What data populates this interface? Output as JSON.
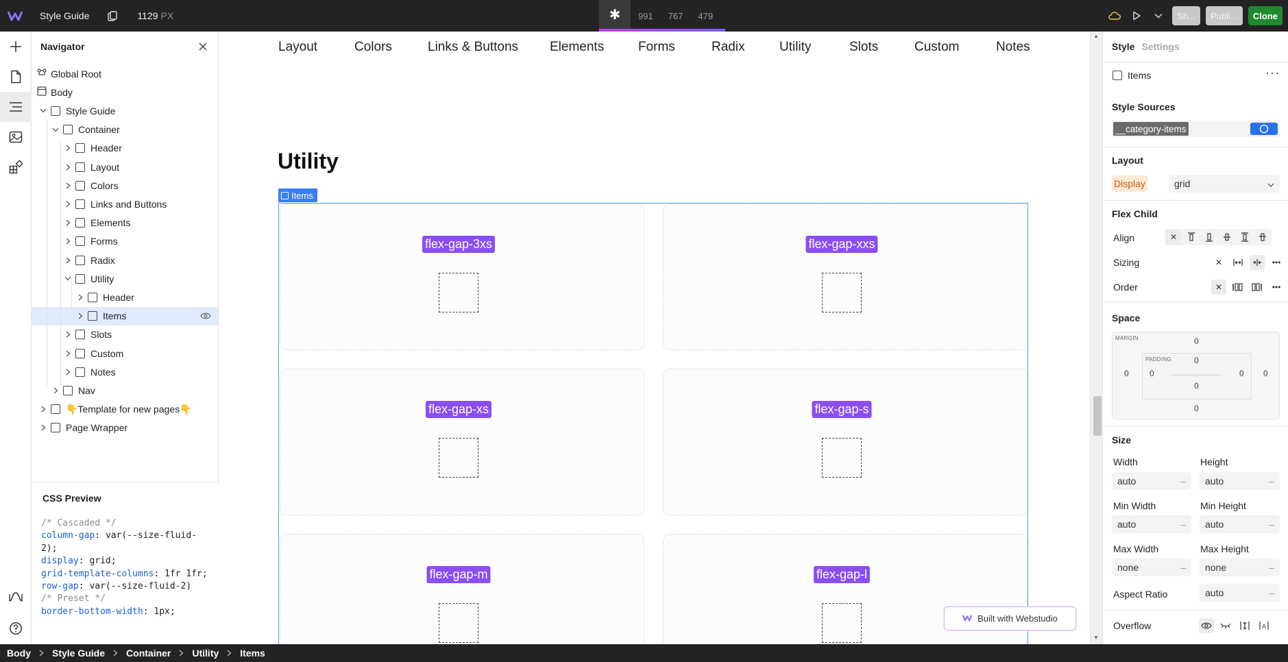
{
  "topbar": {
    "project_name": "Style Guide",
    "canvas_width": "1129",
    "canvas_unit": "PX",
    "breakpoints": [
      "991",
      "767",
      "479"
    ],
    "share_label": "Sh...",
    "publish_label": "Publi...",
    "clone_label": "Clone"
  },
  "navigator": {
    "title": "Navigator",
    "tree": [
      {
        "label": "Global Root",
        "depth": 0,
        "icon": "global-root-icon",
        "expand": "none"
      },
      {
        "label": "Body",
        "depth": 0,
        "icon": "body-icon",
        "expand": "none"
      },
      {
        "label": "Style Guide",
        "depth": 1,
        "icon": "box-icon",
        "expand": "open"
      },
      {
        "label": "Container",
        "depth": 2,
        "icon": "box-icon",
        "expand": "open"
      },
      {
        "label": "Header",
        "depth": 3,
        "icon": "box-icon",
        "expand": "closed"
      },
      {
        "label": "Layout",
        "depth": 3,
        "icon": "box-icon",
        "expand": "closed"
      },
      {
        "label": "Colors",
        "depth": 3,
        "icon": "box-icon",
        "expand": "closed"
      },
      {
        "label": "Links and Buttons",
        "depth": 3,
        "icon": "box-icon",
        "expand": "closed"
      },
      {
        "label": "Elements",
        "depth": 3,
        "icon": "box-icon",
        "expand": "closed"
      },
      {
        "label": "Forms",
        "depth": 3,
        "icon": "box-icon",
        "expand": "closed"
      },
      {
        "label": "Radix",
        "depth": 3,
        "icon": "box-icon",
        "expand": "closed"
      },
      {
        "label": "Utility",
        "depth": 3,
        "icon": "box-icon",
        "expand": "open"
      },
      {
        "label": "Header",
        "depth": 4,
        "icon": "box-icon",
        "expand": "closed"
      },
      {
        "label": "Items",
        "depth": 4,
        "icon": "box-icon",
        "expand": "closed",
        "selected": true
      },
      {
        "label": "Slots",
        "depth": 3,
        "icon": "box-icon",
        "expand": "closed"
      },
      {
        "label": "Custom",
        "depth": 3,
        "icon": "box-icon",
        "expand": "closed"
      },
      {
        "label": "Notes",
        "depth": 3,
        "icon": "box-icon",
        "expand": "closed"
      },
      {
        "label": "Nav",
        "depth": 2,
        "icon": "box-icon",
        "expand": "closed"
      },
      {
        "label": "👇Template for new pages👇",
        "depth": 1,
        "icon": "box-icon",
        "expand": "closed"
      },
      {
        "label": "Page Wrapper",
        "depth": 1,
        "icon": "box-icon",
        "expand": "closed"
      }
    ]
  },
  "css_preview": {
    "title": "CSS Preview",
    "lines": [
      {
        "type": "comment",
        "text": "/* Cascaded */"
      },
      {
        "type": "decl",
        "prop": "column-gap",
        "value": "var(--size-fluid-2);"
      },
      {
        "type": "decl",
        "prop": "display",
        "value": "grid;"
      },
      {
        "type": "decl",
        "prop": "grid-template-columns",
        "value": "1fr 1fr;"
      },
      {
        "type": "decl",
        "prop": "row-gap",
        "value": "var(--size-fluid-2)"
      },
      {
        "type": "comment",
        "text": "/* Preset */"
      },
      {
        "type": "decl",
        "prop": "border-bottom-width",
        "value": "1px;"
      }
    ]
  },
  "canvas": {
    "nav_links": [
      "Layout",
      "Colors",
      "Links & Buttons",
      "Elements",
      "Forms",
      "Radix",
      "Utility",
      "Slots",
      "Custom",
      "Notes"
    ],
    "page_title": "Utility",
    "selection_label": "Items",
    "cells": [
      "flex-gap-3xs",
      "flex-gap-xxs",
      "flex-gap-xs",
      "flex-gap-s",
      "flex-gap-m",
      "flex-gap-l"
    ],
    "built_with": "Built with Webstudio"
  },
  "style_panel": {
    "tab_style": "Style",
    "tab_settings": "Settings",
    "element_name": "Items",
    "style_sources_title": "Style Sources",
    "style_source_token": "__category-items",
    "layout_title": "Layout",
    "display_label": "Display",
    "display_value": "grid",
    "flex_child_title": "Flex Child",
    "align_label": "Align",
    "sizing_label": "Sizing",
    "order_label": "Order",
    "space_title": "Space",
    "margin_caption": "MARGIN",
    "padding_caption": "PADDING",
    "margin": {
      "top": "0",
      "right": "0",
      "bottom": "0",
      "left": "0"
    },
    "padding": {
      "top": "0",
      "right": "0",
      "bottom": "0",
      "left": "0"
    },
    "size_title": "Size",
    "width_label": "Width",
    "width_value": "auto",
    "height_label": "Height",
    "height_value": "auto",
    "min_width_label": "Min Width",
    "min_width_value": "auto",
    "min_height_label": "Min Height",
    "min_height_value": "auto",
    "max_width_label": "Max Width",
    "max_width_value": "none",
    "max_height_label": "Max Height",
    "max_height_value": "none",
    "aspect_ratio_label": "Aspect Ratio",
    "aspect_ratio_value": "auto",
    "overflow_label": "Overflow"
  },
  "breadcrumb": [
    "Body",
    "Style Guide",
    "Container",
    "Utility",
    "Items"
  ],
  "colors": {
    "accent": "#8a4ef2",
    "selection": "#3a7ef4",
    "clone": "#1f8a2f"
  }
}
